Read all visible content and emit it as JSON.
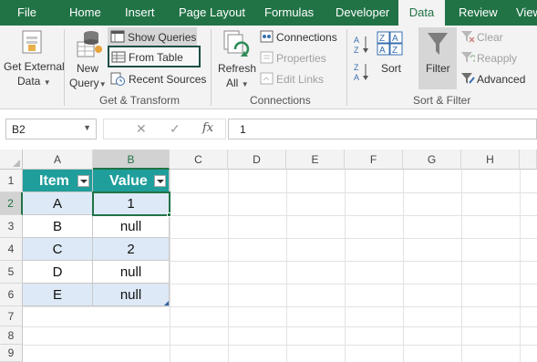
{
  "tabs": [
    {
      "label": "File",
      "active": false
    },
    {
      "label": "Home",
      "active": false
    },
    {
      "label": "Insert",
      "active": false
    },
    {
      "label": "Page Layout",
      "active": false
    },
    {
      "label": "Formulas",
      "active": false
    },
    {
      "label": "Developer",
      "active": false
    },
    {
      "label": "Data",
      "active": true
    },
    {
      "label": "Review",
      "active": false
    },
    {
      "label": "View",
      "active": false
    }
  ],
  "ribbon": {
    "get_external_data": {
      "line1": "Get External",
      "line2": "Data"
    },
    "new_query": {
      "line1": "New",
      "line2": "Query"
    },
    "show_queries": "Show Queries",
    "from_table": "From Table",
    "recent_sources": "Recent Sources",
    "group_get_transform": "Get & Transform",
    "refresh_all": {
      "line1": "Refresh",
      "line2": "All"
    },
    "connections": "Connections",
    "properties": "Properties",
    "edit_links": "Edit Links",
    "group_connections": "Connections",
    "sort": "Sort",
    "filter": "Filter",
    "clear": "Clear",
    "reapply": "Reapply",
    "advanced": "Advanced",
    "group_sort_filter": "Sort & Filter"
  },
  "formula_bar": {
    "name_box": "B2",
    "cancel": "✕",
    "enter": "✓",
    "fx": "fx",
    "value": "1"
  },
  "columns": [
    "A",
    "B",
    "C",
    "D",
    "E",
    "F",
    "G",
    "H"
  ],
  "rows": [
    "1",
    "2",
    "3",
    "4",
    "5",
    "6",
    "7",
    "8",
    "9"
  ],
  "table": {
    "headers": [
      "Item",
      "Value"
    ],
    "rows": [
      [
        "A",
        "1"
      ],
      [
        "B",
        "null"
      ],
      [
        "C",
        "2"
      ],
      [
        "D",
        "null"
      ],
      [
        "E",
        "null"
      ]
    ]
  },
  "colors": {
    "excel_green": "#217346",
    "table_header": "#1f9e9b",
    "table_band": "#dde9f6"
  }
}
